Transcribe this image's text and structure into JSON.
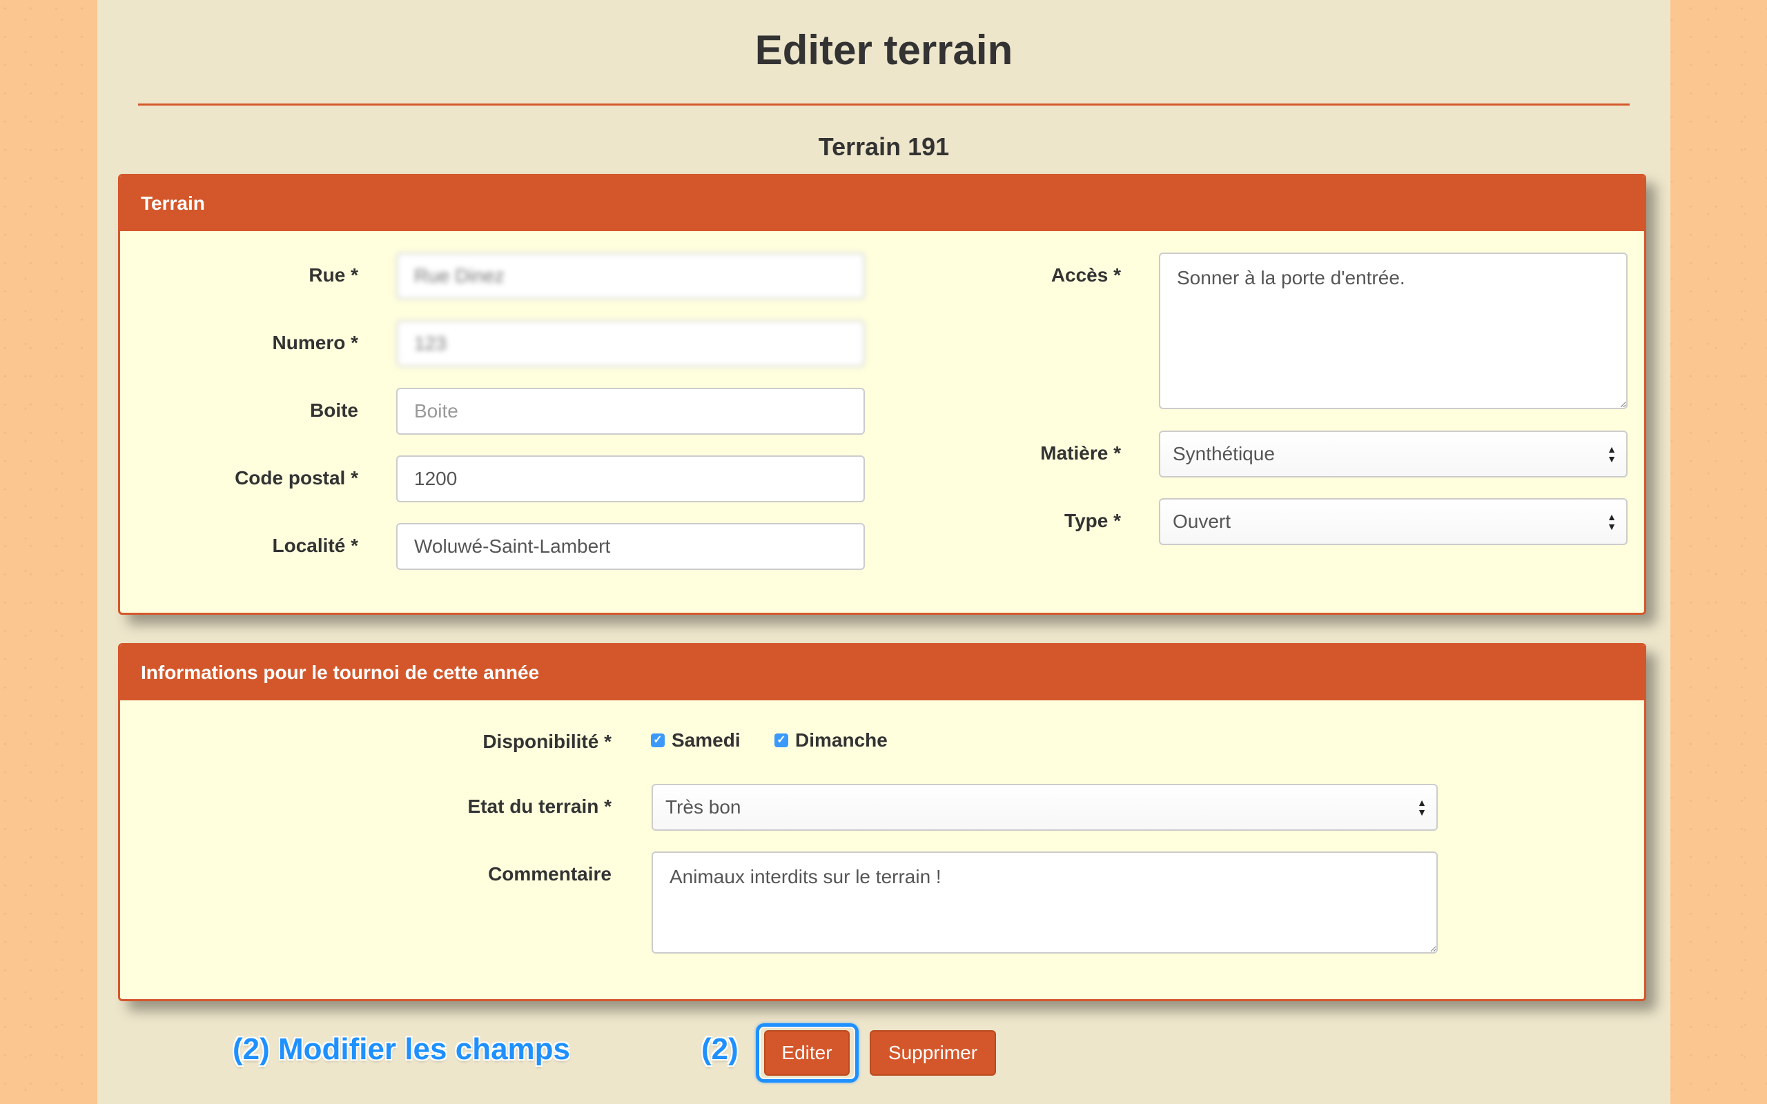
{
  "page": {
    "title": "Editer terrain",
    "subtitle": "Terrain 191"
  },
  "terrain_panel": {
    "heading": "Terrain",
    "rue": {
      "label": "Rue *",
      "value": "Rue Dinez"
    },
    "numero": {
      "label": "Numero *",
      "value": "123"
    },
    "boite": {
      "label": "Boite",
      "placeholder": "Boite",
      "value": ""
    },
    "code_postal": {
      "label": "Code postal *",
      "value": "1200"
    },
    "localite": {
      "label": "Localité *",
      "value": "Woluwé-Saint-Lambert"
    },
    "acces": {
      "label": "Accès *",
      "value": "Sonner à la porte d'entrée."
    },
    "matiere": {
      "label": "Matière *",
      "value": "Synthétique"
    },
    "type": {
      "label": "Type *",
      "value": "Ouvert"
    }
  },
  "tournoi_panel": {
    "heading": "Informations pour le tournoi de cette année",
    "disponibilite": {
      "label": "Disponibilité *",
      "options": [
        {
          "label": "Samedi",
          "checked": true
        },
        {
          "label": "Dimanche",
          "checked": true
        }
      ]
    },
    "etat": {
      "label": "Etat du terrain *",
      "value": "Très bon"
    },
    "commentaire": {
      "label": "Commentaire",
      "value": "Animaux interdits sur le terrain !"
    }
  },
  "actions": {
    "editer_label": "Editer",
    "supprimer_label": "Supprimer"
  },
  "annotations": {
    "step_text": "(2) Modifier les champs",
    "step_marker": "(2)"
  },
  "colors": {
    "accent": "#d4572b",
    "panel_bg": "#ffffde",
    "page_bg": "#eee6cb",
    "outer_bg": "#fbc690",
    "annotation_blue": "#1e90ff",
    "checkbox_blue": "#3b99fc"
  },
  "icons": {
    "checkbox": "check-icon",
    "select_arrows": "select-arrows-icon"
  }
}
